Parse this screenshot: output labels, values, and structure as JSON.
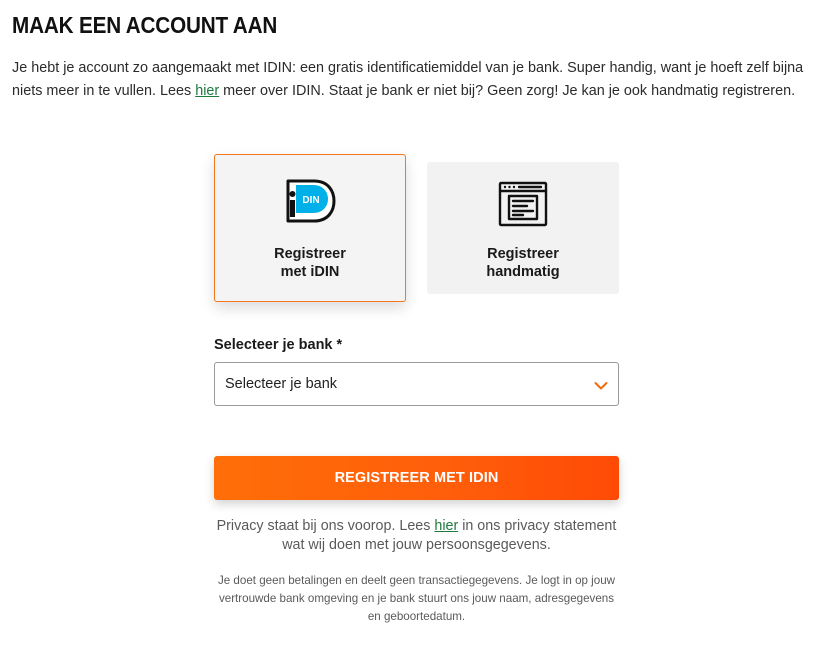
{
  "page": {
    "title": "MAAK EEN ACCOUNT AAN",
    "intro_before_link": "Je hebt je account zo aangemaakt met IDIN: een gratis identificatiemiddel van je bank. Super handig, want je hoeft zelf bijna niets meer in te vullen. Lees ",
    "intro_link": "hier",
    "intro_after_link": " meer over IDIN. Staat je bank er niet bij? Geen zorg! Je kan je ook handmatig registreren."
  },
  "options": {
    "idin": {
      "label": "Registreer\nmet iDIN",
      "icon": "idin-logo-icon",
      "logo_text": "DIN",
      "selected": true
    },
    "manual": {
      "label": "Registreer\nhandmatig",
      "icon": "browser-form-icon",
      "selected": false
    }
  },
  "bank_select": {
    "label": "Selecteer je bank *",
    "value": "Selecteer je bank"
  },
  "submit_label": "REGISTREER MET IDIN",
  "privacy": {
    "before_link": "Privacy staat bij ons voorop. Lees ",
    "link": "hier",
    "after_link": " in ons privacy statement wat wij doen met jouw persoonsgegevens."
  },
  "footnote": "Je doet geen betalingen en deelt geen transactiegegevens. Je logt in op jouw vertrouwde bank omgeving en je bank stuurt ons jouw naam, adresgegevens en geboortedatum.",
  "colors": {
    "accent": "#ff5d0a",
    "selected_border": "#f0781e",
    "link": "#1f7a3d",
    "idin_blue": "#00b0e8"
  }
}
